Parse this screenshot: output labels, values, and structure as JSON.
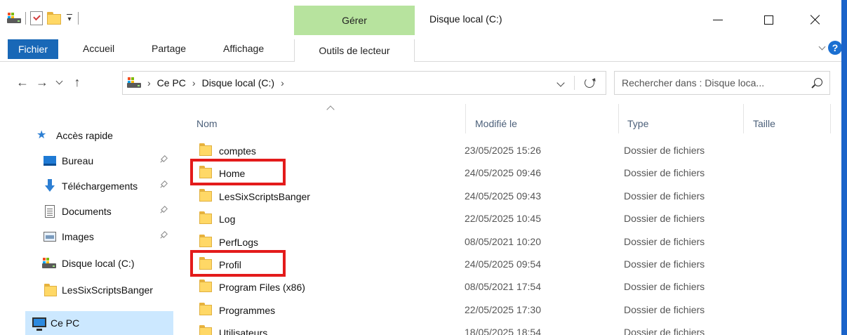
{
  "window": {
    "title": "Disque local (C:)",
    "contextual_group": "Gérer"
  },
  "ribbon": {
    "tabs": [
      {
        "label": "Fichier"
      },
      {
        "label": "Accueil"
      },
      {
        "label": "Partage"
      },
      {
        "label": "Affichage"
      },
      {
        "label": "Outils de lecteur"
      }
    ]
  },
  "address_bar": {
    "breadcrumbs": [
      "Ce PC",
      "Disque local (C:)"
    ],
    "search_placeholder": "Rechercher dans : Disque loca..."
  },
  "nav_pane": {
    "quick_access_label": "Accès rapide",
    "items": [
      {
        "label": "Bureau",
        "icon": "desktop-icon",
        "pinned": true
      },
      {
        "label": "Téléchargements",
        "icon": "download-icon",
        "pinned": true
      },
      {
        "label": "Documents",
        "icon": "document-icon",
        "pinned": true
      },
      {
        "label": "Images",
        "icon": "image-icon",
        "pinned": true
      },
      {
        "label": "Disque local (C:)",
        "icon": "drive-icon",
        "pinned": false
      },
      {
        "label": "LesSixScriptsBanger",
        "icon": "folder-icon",
        "pinned": false
      }
    ],
    "this_pc_label": "Ce PC"
  },
  "file_list": {
    "columns": [
      "Nom",
      "Modifié le",
      "Type",
      "Taille"
    ],
    "rows": [
      {
        "name": "comptes",
        "modified": "23/05/2025 15:26",
        "type": "Dossier de fichiers",
        "highlighted": false
      },
      {
        "name": "Home",
        "modified": "24/05/2025 09:46",
        "type": "Dossier de fichiers",
        "highlighted": true
      },
      {
        "name": "LesSixScriptsBanger",
        "modified": "24/05/2025 09:43",
        "type": "Dossier de fichiers",
        "highlighted": false
      },
      {
        "name": "Log",
        "modified": "22/05/2025 10:45",
        "type": "Dossier de fichiers",
        "highlighted": false
      },
      {
        "name": "PerfLogs",
        "modified": "08/05/2021 10:20",
        "type": "Dossier de fichiers",
        "highlighted": false
      },
      {
        "name": "Profil",
        "modified": "24/05/2025 09:54",
        "type": "Dossier de fichiers",
        "highlighted": true
      },
      {
        "name": "Program Files (x86)",
        "modified": "08/05/2021 17:54",
        "type": "Dossier de fichiers",
        "highlighted": false
      },
      {
        "name": "Programmes",
        "modified": "22/05/2025 17:30",
        "type": "Dossier de fichiers",
        "highlighted": false
      },
      {
        "name": "Utilisateurs",
        "modified": "18/05/2025 18:54",
        "type": "Dossier de fichiers",
        "highlighted": false
      }
    ]
  },
  "colors": {
    "file_tab": "#1968b7",
    "manage_tab": "#b7e39e",
    "selection": "#cce8ff",
    "highlight_box": "#e31b1b",
    "folder": "#ffd866"
  }
}
